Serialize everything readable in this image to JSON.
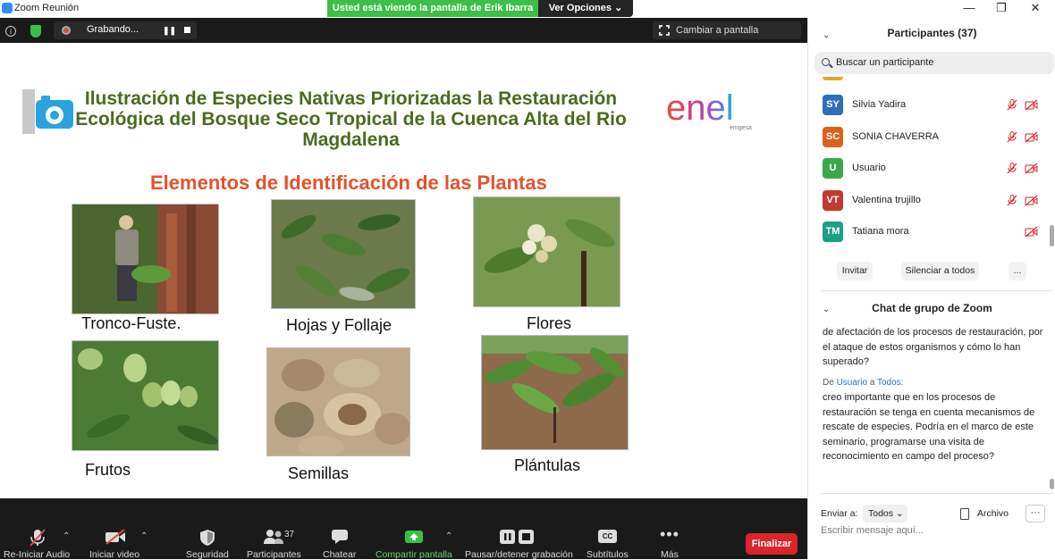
{
  "window": {
    "title": "Zoom Reunión",
    "minimize": "—",
    "maximize": "❐",
    "close": "✕"
  },
  "share_banner": {
    "text": "Usted está viendo la pantalla de Erik Ibarra",
    "view_options": "Ver Opciones ⌄"
  },
  "meeting_bar": {
    "info": "i",
    "recording_label": "Grabando...",
    "pause": "❚❚",
    "fullscreen_label": "Cambiar a pantalla completa"
  },
  "slide": {
    "title": "Ilustración de Especies Nativas Priorizadas la Restauración Ecológica del Bosque Seco Tropical de la Cuenca Alta del Rio Magdalena",
    "logo_text": "enel",
    "logo_sub": "emgesa",
    "subtitle": "Elementos de Identificación de las Plantas",
    "captions": {
      "tronco": "Tronco-Fuste.",
      "hojas": "Hojas y Follaje",
      "flores": "Flores",
      "frutos": "Frutos",
      "semillas": "Semillas",
      "plantulas": "Plántulas"
    }
  },
  "toolbar": {
    "audio": "Re-Iniciar Audio",
    "video": "Iniciar video",
    "security": "Seguridad",
    "participants": "Participantes",
    "participants_count": "37",
    "chat": "Chatear",
    "share": "Compartir pantalla",
    "record": "Pausar/detener grabación",
    "subtitles": "Subtítulos",
    "subtitles_icon": "CC",
    "more": "Más",
    "end": "Finalizar"
  },
  "participants_panel": {
    "header": "Participantes (37)",
    "search_placeholder": "Buscar un participante",
    "list": [
      {
        "initials": "SY",
        "name": "Silvia Yadira",
        "color": "#2e6fb5",
        "mic_muted": true
      },
      {
        "initials": "SC",
        "name": "SONIA CHAVERRA",
        "color": "#d9621e",
        "mic_muted": true
      },
      {
        "initials": "U",
        "name": "Usuario",
        "color": "#3aa84a",
        "mic_muted": true
      },
      {
        "initials": "VT",
        "name": "Valentina trujillo",
        "color": "#c4392f",
        "mic_muted": true
      },
      {
        "initials": "TM",
        "name": "Tatiana mora",
        "color": "#1aa085",
        "mic_muted": false
      }
    ],
    "invite": "Invitar",
    "mute_all": "Silenciar a todos",
    "more": "..."
  },
  "chat_panel": {
    "header": "Chat de grupo de Zoom",
    "prev_message": "de afectación de los procesos de restauración, por el ataque de estos organismos y cómo lo han superado?",
    "from_prefix": "De",
    "from": "Usuario",
    "to_prefix": "a",
    "to": "Todos",
    "to_suffix": ":",
    "message": "creo importante que en los procesos de restauración se tenga en cuenta mecanismos de rescate de especies. Podría en el marco de este seminario, programarse una visita de reconocimiento en campo del proceso?",
    "send_to_label": "Enviar a:",
    "send_to_value": "Todos ⌄",
    "file_label": "Archivo",
    "more": "···",
    "input_placeholder": "Escribir mensaje aquí..."
  }
}
